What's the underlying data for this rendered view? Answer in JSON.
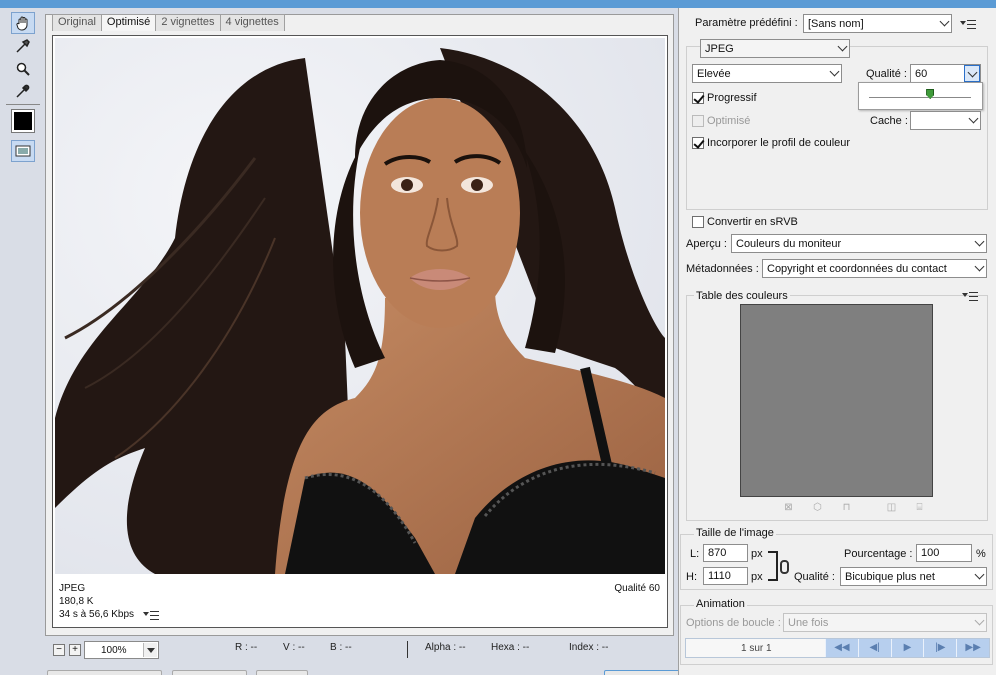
{
  "view_tabs": [
    "Original",
    "Optimisé",
    "2 vignettes",
    "4 vignettes"
  ],
  "preview": {
    "format": "JPEG",
    "size": "180,8 K",
    "download_time": "34 s à 56,6 Kbps",
    "quality_label": "Qualité 60"
  },
  "status_bar": {
    "zoom_minus": "−",
    "zoom_plus": "+",
    "zoom_value": "100%",
    "r": "R : --",
    "v": "V : --",
    "b": "B : --",
    "alpha": "Alpha : --",
    "hexa": "Hexa : --",
    "index": "Index : --"
  },
  "settings": {
    "preset_label": "Paramètre prédéfini :",
    "preset_value": "[Sans nom]",
    "format_value": "JPEG",
    "compression_value": "Elevée",
    "quality_label": "Qualité :",
    "quality_value": "60",
    "quality_slider_fraction": 0.6,
    "progressive_label": "Progressif",
    "progressive_checked": true,
    "optimized_label": "Optimisé",
    "optimized_checked": false,
    "embed_profile_label": "Incorporer le profil de couleur",
    "embed_profile_checked": true,
    "cache_label": "Cache :",
    "cache_value": "",
    "srgb_label": "Convertir en sRVB",
    "srgb_checked": false,
    "preview_label": "Aperçu :",
    "preview_value": "Couleurs du moniteur",
    "metadata_label": "Métadonnées :",
    "metadata_value": "Copyright et coordonnées du contact"
  },
  "color_table": {
    "title": "Table des couleurs",
    "swatch_color": "#7f7f7f"
  },
  "image_size": {
    "title": "Taille de l'image",
    "width_label": "L:",
    "width_value": "870",
    "height_label": "H:",
    "height_value": "1110",
    "unit": "px",
    "percent_label": "Pourcentage :",
    "percent_value": "100",
    "percent_unit": "%",
    "quality_label": "Qualité :",
    "quality_value": "Bicubique plus net"
  },
  "animation": {
    "title": "Animation",
    "loop_label": "Options de boucle :",
    "loop_value": "Une fois",
    "frame_counter": "1 sur 1"
  },
  "colors": {
    "accent": "#5b9bd5",
    "panel_bg": "#f0f0f0",
    "tools_bg": "#d9dde6"
  }
}
